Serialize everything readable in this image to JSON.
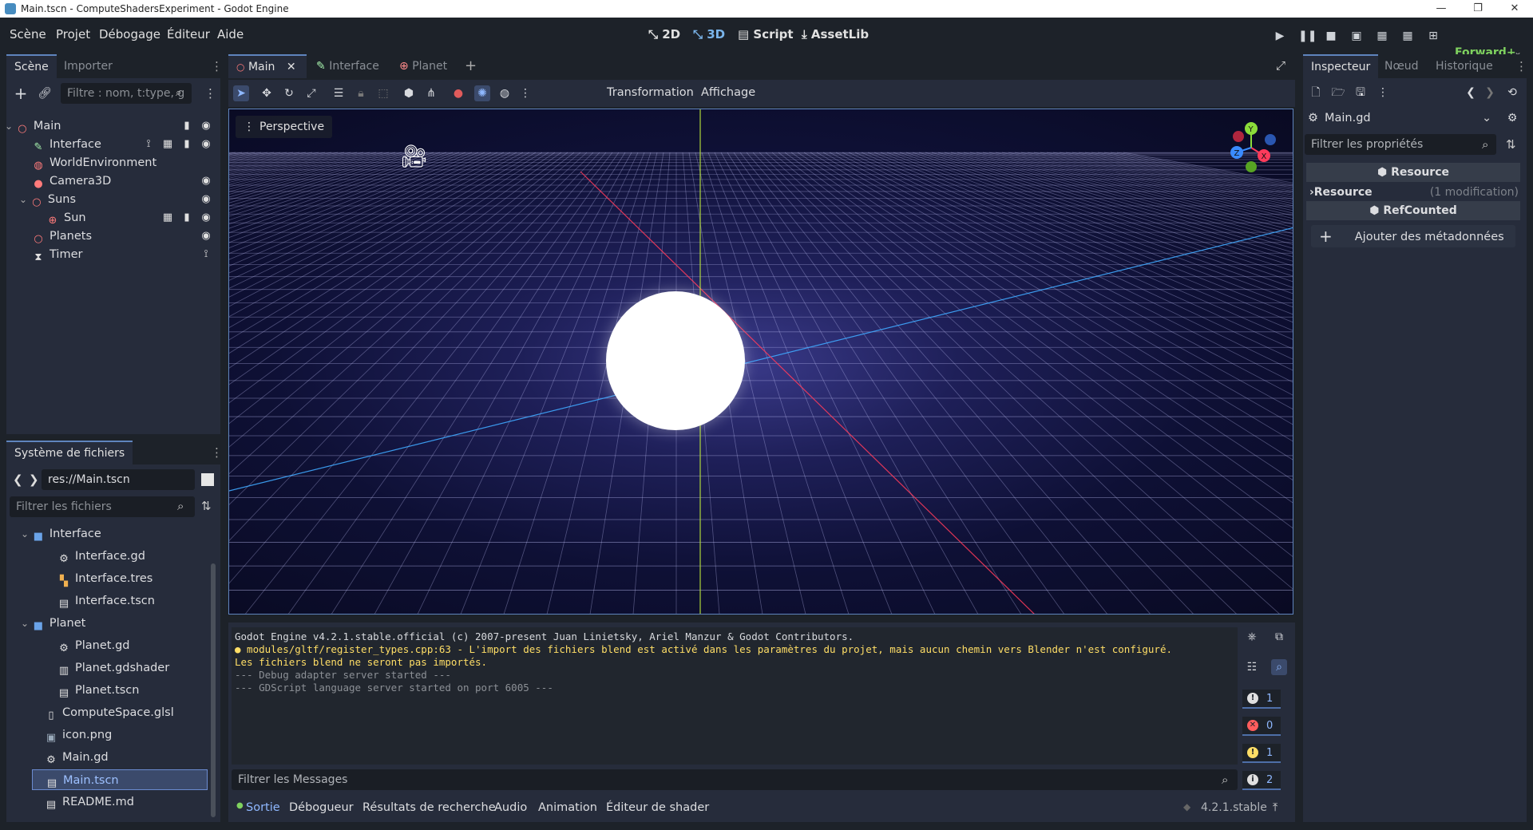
{
  "window": {
    "title": "Main.tscn - ComputeShadersExperiment - Godot Engine"
  },
  "menu": {
    "items": [
      "Scène",
      "Projet",
      "Débogage",
      "Éditeur",
      "Aide"
    ],
    "modes": [
      "2D",
      "3D",
      "Script",
      "AssetLib"
    ],
    "active_mode": "3D",
    "renderer": "Forward+"
  },
  "scene_dock": {
    "tabs": [
      "Scène",
      "Importer"
    ],
    "filter_placeholder": "Filtre : nom, t:type, g",
    "nodes": [
      {
        "label": "Main",
        "icon": "node3d-icon",
        "indent": 0
      },
      {
        "label": "Interface",
        "icon": "control-icon",
        "indent": 1
      },
      {
        "label": "WorldEnvironment",
        "icon": "world-environment-icon",
        "indent": 1
      },
      {
        "label": "Camera3D",
        "icon": "camera-icon",
        "indent": 1
      },
      {
        "label": "Suns",
        "icon": "node3d-icon",
        "indent": 1
      },
      {
        "label": "Sun",
        "icon": "scene-instance-icon",
        "indent": 2
      },
      {
        "label": "Planets",
        "icon": "node3d-icon",
        "indent": 1
      },
      {
        "label": "Timer",
        "icon": "timer-icon",
        "indent": 1
      }
    ]
  },
  "filesystem_dock": {
    "title": "Système de fichiers",
    "path": "res://Main.tscn",
    "filter_placeholder": "Filtrer les fichiers",
    "files": [
      {
        "label": "Interface",
        "icon": "folder-icon",
        "indent": 1
      },
      {
        "label": "Interface.gd",
        "icon": "gear-icon",
        "indent": 2
      },
      {
        "label": "Interface.tres",
        "icon": "theme-icon",
        "indent": 2
      },
      {
        "label": "Interface.tscn",
        "icon": "scene-file-icon",
        "indent": 2
      },
      {
        "label": "Planet",
        "icon": "folder-icon",
        "indent": 1
      },
      {
        "label": "Planet.gd",
        "icon": "gear-icon",
        "indent": 2
      },
      {
        "label": "Planet.gdshader",
        "icon": "shader-icon",
        "indent": 2
      },
      {
        "label": "Planet.tscn",
        "icon": "scene-file-icon",
        "indent": 2
      },
      {
        "label": "ComputeSpace.glsl",
        "icon": "file-icon",
        "indent": 1
      },
      {
        "label": "icon.png",
        "icon": "image-icon",
        "indent": 1
      },
      {
        "label": "Main.gd",
        "icon": "gear-icon",
        "indent": 1
      },
      {
        "label": "Main.tscn",
        "icon": "scene-file-icon",
        "indent": 1,
        "selected": true
      },
      {
        "label": "README.md",
        "icon": "doc-icon",
        "indent": 1
      }
    ]
  },
  "editor_tabs": [
    "Main",
    "Interface",
    "Planet"
  ],
  "viewport_toolbar": {
    "menus": [
      "Transformation",
      "Affichage"
    ],
    "view_label": "Perspective"
  },
  "output": {
    "lines": [
      {
        "text": "Godot Engine v4.2.1.stable.official (c) 2007-present Juan Linietsky, Ariel Manzur & Godot Contributors.",
        "kind": "normal"
      },
      {
        "text": "● modules/gltf/register_types.cpp:63 - L'import des fichiers blend est activé dans les paramètres du projet, mais aucun chemin vers Blender n'est configuré.",
        "kind": "warning"
      },
      {
        "text": "Les fichiers blend ne seront pas importés.",
        "kind": "warning"
      },
      {
        "text": "--- Debug adapter server started ---",
        "kind": "dim"
      },
      {
        "text": "--- GDScript language server started on port 6005 ---",
        "kind": "dim"
      }
    ],
    "filter_placeholder": "Filtrer les Messages",
    "counters": [
      {
        "value": "1",
        "icon": "message-icon",
        "color": "#e0e0e0"
      },
      {
        "value": "0",
        "icon": "error-icon",
        "color": "#ff5d5d"
      },
      {
        "value": "1",
        "icon": "warning-icon",
        "color": "#ffde66"
      },
      {
        "value": "2",
        "icon": "info-icon",
        "color": "#e0e0e0"
      }
    ]
  },
  "bottom_tabs": [
    "Sortie",
    "Débogueur",
    "Résultats de recherche",
    "Audio",
    "Animation",
    "Éditeur de shader"
  ],
  "version": "4.2.1.stable",
  "inspector": {
    "tabs": [
      "Inspecteur",
      "Nœud",
      "Historique"
    ],
    "resource_name": "Main.gd",
    "filter_placeholder": "Filtrer les propriétés",
    "section_resource": "Resource",
    "property_resource": "Resource",
    "property_resource_note": "(1 modification)",
    "section_refcounted": "RefCounted",
    "add_metadata": "Ajouter des métadonnées"
  },
  "colors": {
    "accent": "#5f84bd",
    "warning": "#ffde66",
    "panel": "#262c3b",
    "background": "#1d2229"
  }
}
